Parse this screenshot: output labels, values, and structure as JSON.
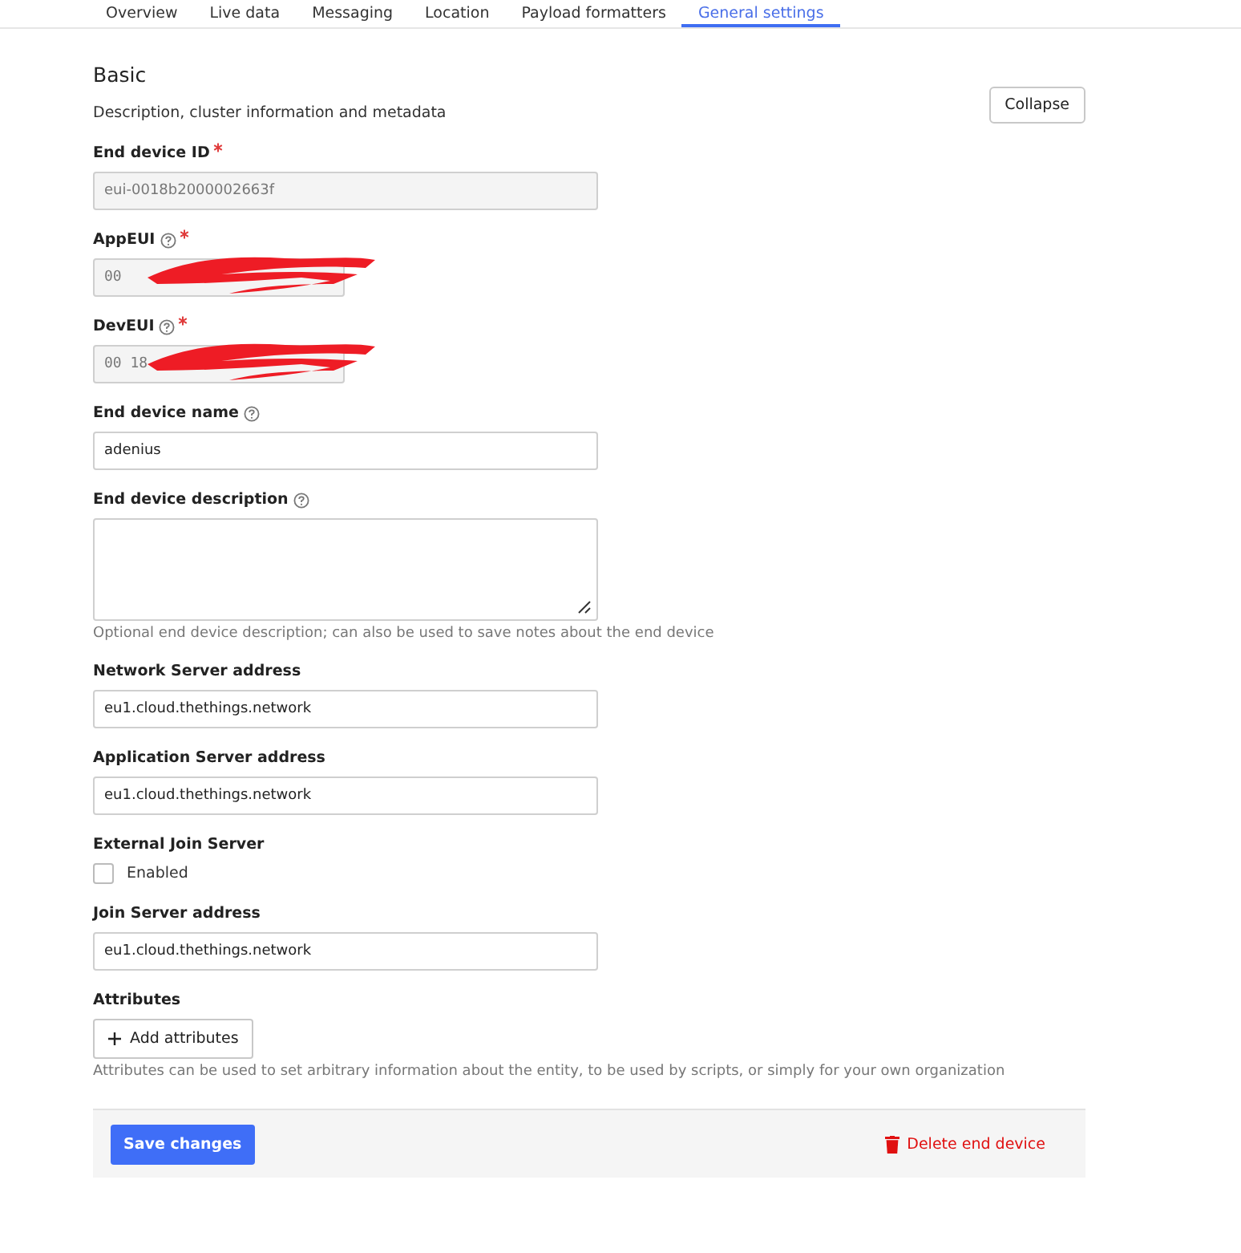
{
  "tabs": [
    {
      "label": "Overview",
      "selected": false
    },
    {
      "label": "Live data",
      "selected": false
    },
    {
      "label": "Messaging",
      "selected": false
    },
    {
      "label": "Location",
      "selected": false
    },
    {
      "label": "Payload formatters",
      "selected": false
    },
    {
      "label": "General settings",
      "selected": true
    }
  ],
  "section": {
    "title": "Basic",
    "subtitle": "Description, cluster information and metadata",
    "collapse_button": "Collapse"
  },
  "fields": [
    {
      "kind": "text",
      "label": "End device ID",
      "required": true,
      "help": false,
      "value": "eui-0018b2000002663f",
      "disabled": true
    },
    {
      "kind": "hex",
      "label": "AppEUI",
      "required": true,
      "help": true,
      "value": "00",
      "disabled": true,
      "redacted": true
    },
    {
      "kind": "hex",
      "label": "DevEUI",
      "required": true,
      "help": true,
      "value": "00 18",
      "disabled": true,
      "redacted": true
    },
    {
      "kind": "text",
      "label": "End device name",
      "required": false,
      "help": true,
      "value": "adenius",
      "disabled": false
    },
    {
      "kind": "textarea",
      "label": "End device description",
      "required": false,
      "help": true,
      "description": "Optional end device description; can also be used to save notes about the end device"
    },
    {
      "kind": "text",
      "label": "Network Server address",
      "required": false,
      "help": false,
      "value": "eu1.cloud.thethings.network",
      "disabled": false
    },
    {
      "kind": "text",
      "label": "Application Server address",
      "required": false,
      "help": false,
      "value": "eu1.cloud.thethings.network",
      "disabled": false
    },
    {
      "kind": "checkbox",
      "label": "External Join Server",
      "option": "Enabled",
      "checked": false
    },
    {
      "kind": "text",
      "label": "Join Server address",
      "required": false,
      "help": false,
      "value": "eu1.cloud.thethings.network",
      "disabled": false
    },
    {
      "kind": "attributes",
      "label": "Attributes",
      "button": "Add attributes",
      "description": "Attributes can be used to set arbitrary information about the entity, to be used by scripts, or simply for your own organization"
    }
  ],
  "footer": {
    "save_button": "Save changes",
    "delete_button": "Delete end device"
  }
}
